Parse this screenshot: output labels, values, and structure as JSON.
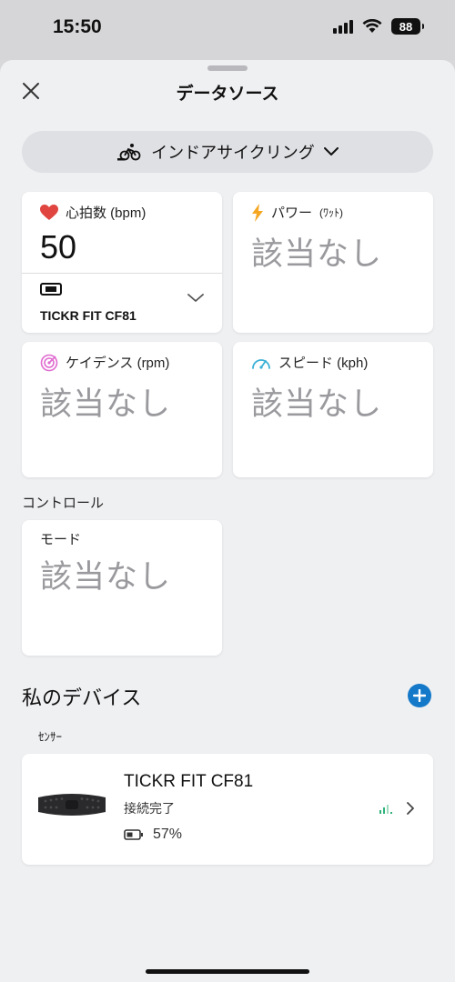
{
  "status_bar": {
    "time": "15:50",
    "battery": "88"
  },
  "sheet": {
    "title": "データソース"
  },
  "activity": {
    "label": "インドアサイクリング"
  },
  "metrics": {
    "heart_rate": {
      "label": "心拍数 (bpm)",
      "value": "50",
      "sensor": "TICKR FIT CF81"
    },
    "power": {
      "label": "パワー",
      "unit": "(ﾜｯﾄ)",
      "value": "該当なし"
    },
    "cadence": {
      "label": "ケイデンス (rpm)",
      "value": "該当なし"
    },
    "speed": {
      "label": "スピード (kph)",
      "value": "該当なし"
    }
  },
  "controls": {
    "section_label": "コントロール",
    "mode": {
      "label": "モード",
      "value": "該当なし"
    }
  },
  "devices": {
    "title": "私のデバイス",
    "sensor_label": "ｾﾝｻｰ",
    "items": [
      {
        "name": "TICKR FIT CF81",
        "status": "接続完了",
        "battery": "57%"
      }
    ]
  },
  "colors": {
    "accent": "#1479c9",
    "heart": "#e0453f",
    "power": "#f5a623",
    "cadence": "#e06bd0",
    "speed": "#3bb0d6",
    "signal": "#2fb37a"
  }
}
